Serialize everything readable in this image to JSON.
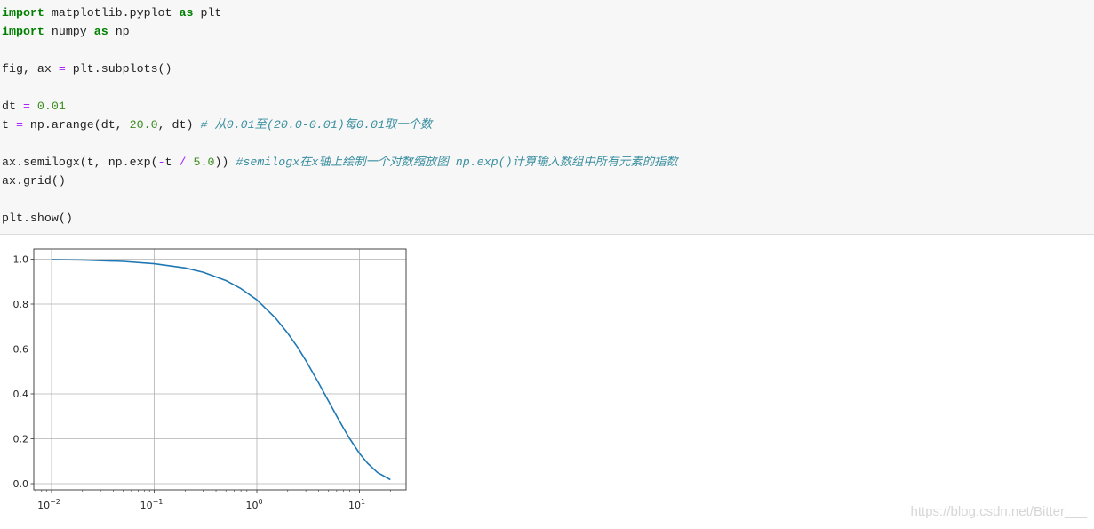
{
  "code": {
    "lines": [
      [
        {
          "t": "import",
          "c": "kw"
        },
        {
          "t": " matplotlib.pyplot ",
          "c": ""
        },
        {
          "t": "as",
          "c": "kw"
        },
        {
          "t": " plt",
          "c": ""
        }
      ],
      [
        {
          "t": "import",
          "c": "kw"
        },
        {
          "t": " numpy ",
          "c": ""
        },
        {
          "t": "as",
          "c": "kw"
        },
        {
          "t": " np",
          "c": ""
        }
      ],
      [],
      [
        {
          "t": "fig, ax ",
          "c": ""
        },
        {
          "t": "=",
          "c": "op"
        },
        {
          "t": " plt.subplots()",
          "c": ""
        }
      ],
      [],
      [
        {
          "t": "dt ",
          "c": ""
        },
        {
          "t": "=",
          "c": "op"
        },
        {
          "t": " ",
          "c": ""
        },
        {
          "t": "0.01",
          "c": "num"
        }
      ],
      [
        {
          "t": "t ",
          "c": ""
        },
        {
          "t": "=",
          "c": "op"
        },
        {
          "t": " np.arange(dt, ",
          "c": ""
        },
        {
          "t": "20.0",
          "c": "num"
        },
        {
          "t": ", dt) ",
          "c": ""
        },
        {
          "t": "# 从0.01至(20.0-0.01)每0.01取一个数",
          "c": "cm"
        }
      ],
      [],
      [
        {
          "t": "ax.semilogx(t, np.exp(",
          "c": ""
        },
        {
          "t": "-",
          "c": "op"
        },
        {
          "t": "t ",
          "c": ""
        },
        {
          "t": "/",
          "c": "op"
        },
        {
          "t": " ",
          "c": ""
        },
        {
          "t": "5.0",
          "c": "num"
        },
        {
          "t": ")) ",
          "c": ""
        },
        {
          "t": "#semilogx在x轴上绘制一个对数缩放图 np.exp()计算输入数组中所有元素的指数",
          "c": "cm"
        }
      ],
      [
        {
          "t": "ax.grid()",
          "c": ""
        }
      ],
      [],
      [
        {
          "t": "plt.show()",
          "c": ""
        }
      ]
    ]
  },
  "chart_data": {
    "type": "line",
    "xscale": "log",
    "yscale": "linear",
    "grid": true,
    "xlim": [
      0.0067,
      28.5
    ],
    "ylim": [
      -0.03,
      1.05
    ],
    "xticks": [
      {
        "base": "10",
        "exp": "−2",
        "value": 0.01
      },
      {
        "base": "10",
        "exp": "−1",
        "value": 0.1
      },
      {
        "base": "10",
        "exp": "0",
        "value": 1
      },
      {
        "base": "10",
        "exp": "1",
        "value": 10
      }
    ],
    "yticks": [
      "0.0",
      "0.2",
      "0.4",
      "0.6",
      "0.8",
      "1.0"
    ],
    "line_color": "#1f77b4",
    "series": [
      {
        "x": [
          0.01,
          0.02,
          0.05,
          0.1,
          0.2,
          0.3,
          0.5,
          0.7,
          1,
          1.5,
          2,
          2.5,
          3,
          4,
          5,
          6,
          7,
          8,
          10,
          12,
          15,
          20
        ],
        "y": [
          0.998,
          0.996,
          0.99,
          0.98,
          0.961,
          0.942,
          0.905,
          0.869,
          0.819,
          0.741,
          0.67,
          0.607,
          0.549,
          0.449,
          0.368,
          0.301,
          0.247,
          0.202,
          0.135,
          0.091,
          0.05,
          0.018
        ]
      }
    ]
  },
  "watermark": "https://blog.csdn.net/Bitter___"
}
